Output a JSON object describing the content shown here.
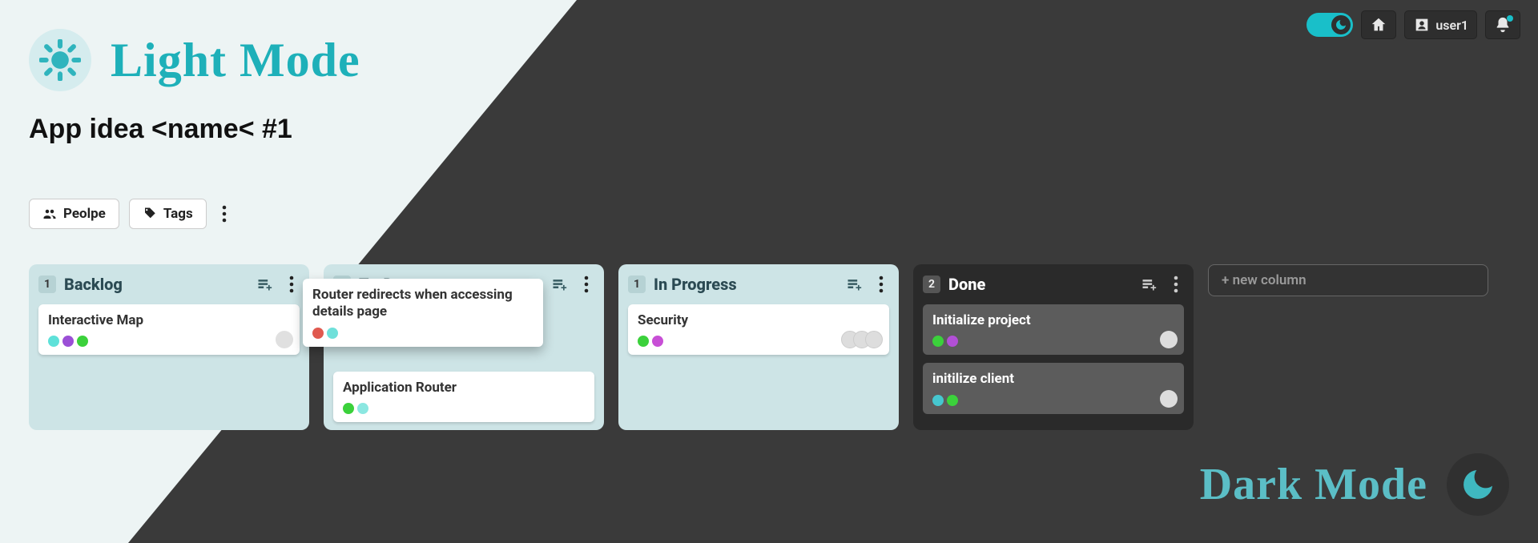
{
  "topbar": {
    "user_label": "user1"
  },
  "light_mode_label": "Light Mode",
  "dark_mode_label": "Dark Mode",
  "board_title": "App idea <name< #1",
  "filters": {
    "people_label": "Peolpe",
    "tags_label": "Tags"
  },
  "columns": [
    {
      "count": "1",
      "title": "Backlog",
      "theme": "light",
      "cards": [
        {
          "title": "Interactive Map",
          "tags": [
            "#5ee1d9",
            "#9b4fd6",
            "#3bd13b"
          ],
          "avatars": 1
        }
      ]
    },
    {
      "count": "3",
      "title": "To-Do",
      "theme": "light",
      "cards": [
        {
          "title": "Application Router",
          "tags": [
            "#3bd13b",
            "#8be7e1"
          ],
          "avatars": 0
        }
      ]
    },
    {
      "count": "1",
      "title": "In Progress",
      "theme": "light",
      "cards": [
        {
          "title": "Security",
          "tags": [
            "#3bd13b",
            "#c84fd6"
          ],
          "avatars": 3
        }
      ]
    },
    {
      "count": "2",
      "title": "Done",
      "theme": "dark",
      "cards": [
        {
          "title": "Initialize project",
          "tags": [
            "#3bd13b",
            "#b24fd6"
          ],
          "avatars": 1
        },
        {
          "title": "initilize client",
          "tags": [
            "#46c7cf",
            "#3bd13b"
          ],
          "avatars": 1
        }
      ]
    }
  ],
  "dragging_card": {
    "title": "Router redirects when accessing details page",
    "tags": [
      "#e0594f",
      "#6fe0da"
    ]
  },
  "new_column_label": "+ new column",
  "tag_colors": {
    "teal": "#5ee1d9",
    "purple": "#9b4fd6",
    "green": "#3bd13b",
    "cyan": "#8be7e1",
    "magenta": "#c84fd6",
    "red": "#e0594f"
  }
}
